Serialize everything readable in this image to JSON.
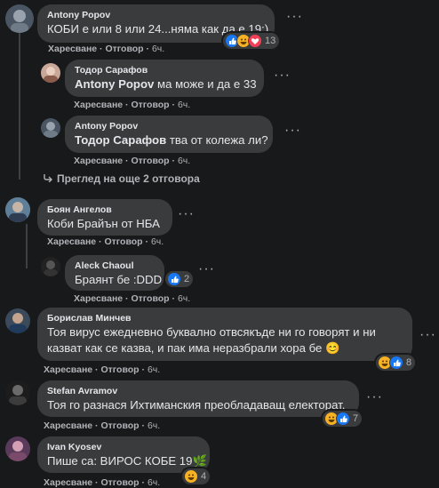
{
  "action_labels": {
    "like": "Харесване",
    "reply": "Отговор",
    "sep": " · "
  },
  "comments": [
    {
      "author": "Antony Popov",
      "text": "КОБИ е или 8 или 24...няма как да е 19:)",
      "time": "6ч.",
      "reactions_count": "13",
      "reaction_icons": [
        "like-icon",
        "haha-icon",
        "love-icon"
      ]
    },
    {
      "author": "Тодор Сарафов",
      "mention": "Antony Popov",
      "text": " ма може и да е 33",
      "time": "6ч."
    },
    {
      "author": "Antony Popov",
      "mention": "Тодор Сарафов",
      "text": " тва от колежа ли?",
      "time": "6ч."
    },
    {
      "author": "Боян Ангелов",
      "text": "Коби Брайън от НБА",
      "time": "6ч."
    },
    {
      "author": "Aleck Chaoul",
      "text": "Браянт бе :DDD",
      "time": "6ч.",
      "reactions_count": "2",
      "reaction_icons": [
        "like-icon"
      ]
    },
    {
      "author": "Борислав Минчев",
      "text": "Тоя вирус ежедневно буквално отвсякъде ни го говорят и ни казват как се казва, и пак има неразбрали хора бе 😊",
      "time": "6ч.",
      "reactions_count": "8",
      "reaction_icons": [
        "haha-icon",
        "like-icon"
      ]
    },
    {
      "author": "Stefan Avramov",
      "text": "Тоя го разнася Ихтиманския преобладаващ електорат.",
      "time": "6ч.",
      "reactions_count": "7",
      "reaction_icons": [
        "haha-icon",
        "like-icon"
      ]
    },
    {
      "author": "Ivan Kyosev",
      "text": "Пише са: ВИРОС КОБЕ 19🌿",
      "time": "6ч.",
      "reactions_count": "4",
      "reaction_icons": [
        "haha-icon"
      ]
    }
  ],
  "view_more_replies": "Преглед на още 2 отговора",
  "colors": {
    "background": "#18191a",
    "bubble": "#3a3b3c",
    "text": "#e4e6eb",
    "secondary": "#b0b3b8",
    "like": "#1877f2",
    "haha": "#f7b125",
    "love": "#f33e58"
  }
}
